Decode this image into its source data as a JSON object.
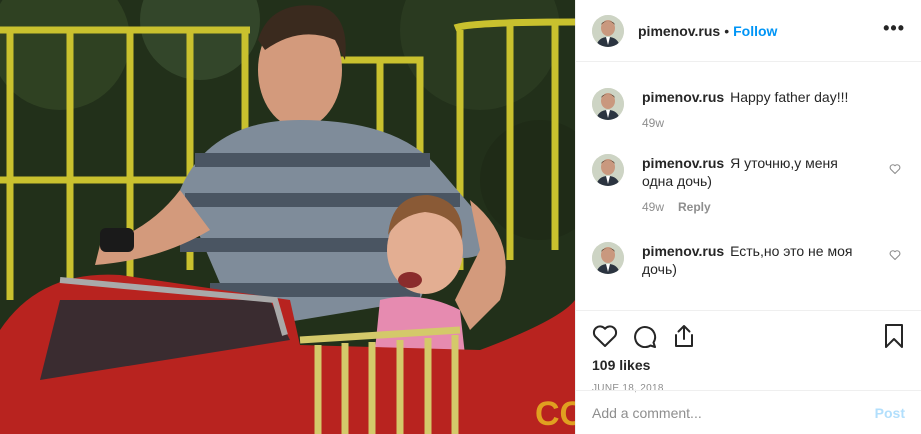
{
  "post": {
    "username": "pimenov.rus",
    "follow_label": "Follow",
    "dot": "•",
    "more_label": "•••"
  },
  "comments": [
    {
      "username": "pimenov.rus",
      "text": "Happy father day!!!",
      "time": "49w",
      "reply": ""
    },
    {
      "username": "pimenov.rus",
      "text": "Я уточню,у меня одна дочь)",
      "time": "49w",
      "reply": "Reply"
    },
    {
      "username": "pimenov.rus",
      "text": "Есть,но это не моя дочь)",
      "time": "",
      "reply": ""
    }
  ],
  "actions": {
    "icons": [
      "heart-icon",
      "comment-icon",
      "share-icon",
      "bookmark-icon"
    ],
    "likes": "109 likes",
    "date": "JUNE 18, 2018"
  },
  "composer": {
    "placeholder": "Add a comment...",
    "post_label": "Post"
  },
  "colors": {
    "link": "#0095f6",
    "muted": "#8e8e8e",
    "post_disabled": "#b2dffc"
  }
}
